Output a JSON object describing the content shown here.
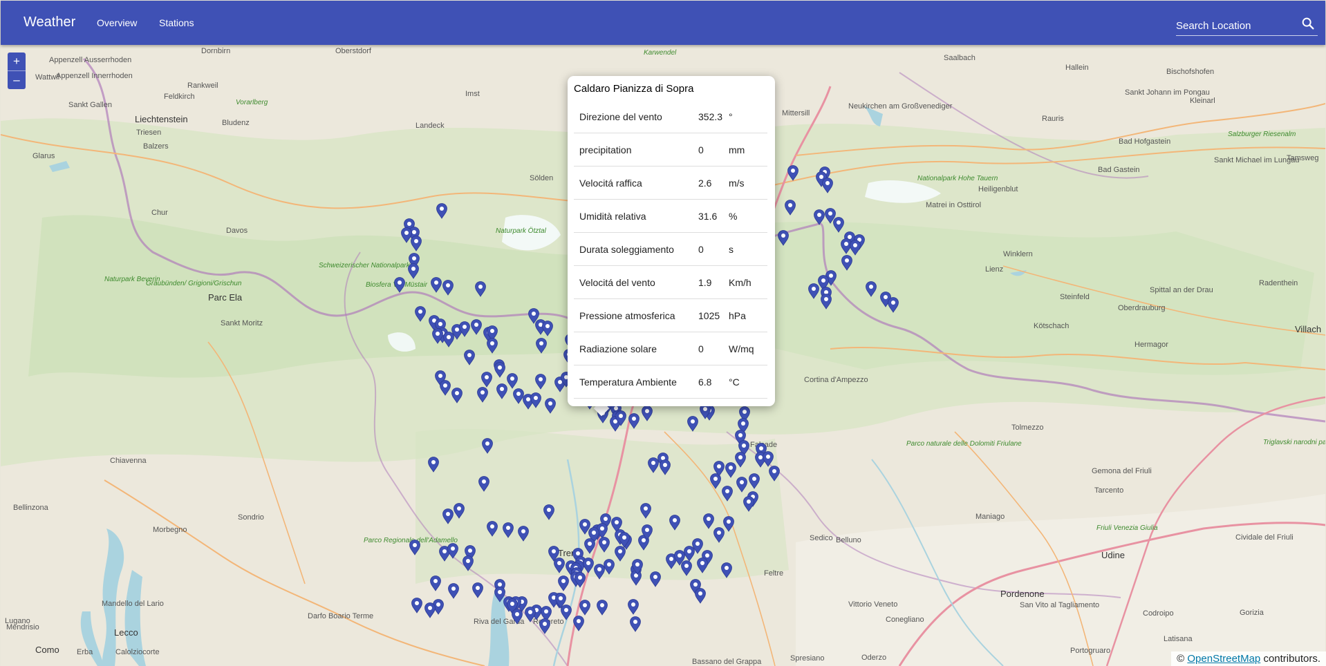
{
  "app": {
    "title": "Weather",
    "nav": [
      "Overview",
      "Stations"
    ]
  },
  "search": {
    "placeholder": "Search Location"
  },
  "zoom": {
    "in": "+",
    "out": "–"
  },
  "popup": {
    "title": "Caldaro Pianizza di Sopra",
    "rows": [
      {
        "name": "Direzione del vento",
        "value": "352.3",
        "unit": "°"
      },
      {
        "name": "precipitation",
        "value": "0",
        "unit": "mm"
      },
      {
        "name": "Velocitá raffica",
        "value": "2.6",
        "unit": "m/s"
      },
      {
        "name": "Umidità relativa",
        "value": "31.6",
        "unit": "%"
      },
      {
        "name": "Durata soleggiamento",
        "value": "0",
        "unit": "s"
      },
      {
        "name": "Velocitá del vento",
        "value": "1.9",
        "unit": "Km/h"
      },
      {
        "name": "Pressione atmosferica",
        "value": "1025",
        "unit": "hPa"
      },
      {
        "name": "Radiazione solare",
        "value": "0",
        "unit": "W/mq"
      },
      {
        "name": "Temperatura Ambiente",
        "value": "6.8",
        "unit": "°C"
      }
    ]
  },
  "attribution": {
    "prefix": "© ",
    "link": "OpenStreetMap",
    "suffix": " contributors."
  },
  "map_labels": [
    "Dornbirn",
    "Oberstdorf",
    "Appenzell Ausserrhoden",
    "Appenzell Innerrhoden",
    "Wattwil",
    "Rankweil",
    "Feldkirch",
    "Sankt Gallen",
    "Liechtenstein",
    "Triesen",
    "Balzers",
    "Vorarlberg",
    "Bludenz",
    "Imst",
    "Landeck",
    "Glarus",
    "Chur",
    "Davos",
    "Parc Ela",
    "Sankt Moritz",
    "Schweizerischer Nationalpark",
    "Naturpark Beverin",
    "Graubünden/ Grigioni/Grischun",
    "Biosfera Val Müstair",
    "Sölden",
    "Naturpark Ötztal",
    "Chiavenna",
    "Bellinzona",
    "Sondrio",
    "Morbegno",
    "Lugano",
    "Mendrisio",
    "Lecco",
    "Como",
    "Erba",
    "Calolziocorte",
    "Mandello del Lario",
    "Darfo Boario Terme",
    "Parco Regionale dell'Adamello",
    "Trento",
    "Riva del Garda",
    "Rovereto",
    "Karwendel",
    "Saalbach",
    "Hallein",
    "Bischofshofen",
    "Bad Hofgastein",
    "Bad Gastein",
    "Salzburger Riesenalm",
    "Nationalpark Hohe Tauern",
    "Heiligenblut",
    "Matrei in Osttirol",
    "Lienz",
    "Spittal an der Drau",
    "Villach",
    "Cortina d'Ampezzo",
    "Tolmezzo",
    "Udine",
    "Pordenone",
    "Conegliano",
    "Vittorio Veneto",
    "Feltre",
    "Belluno",
    "Bassano del Grappa",
    "Gemona del Friuli",
    "Tarcento",
    "Maniago",
    "Sedico",
    "Falcade",
    "Parco naturale delle Dolomiti Friulane",
    "Triglavski narodni park",
    "Friuli Venezia Giulia",
    "Sankt Johann im Pongau",
    "Radenthein",
    "Steinfeld",
    "Kötschach",
    "Winklern",
    "Oberdrauburg",
    "Neukirchen am Großvenediger",
    "Mittersill",
    "Rauris",
    "Kleinarl",
    "Tamsweg",
    "Sankt Michael im Lungau",
    "Hermagor",
    "Cividale del Friuli",
    "Gorizia",
    "Oderzo",
    "Spresiano",
    "Portogruaro",
    "Latisana",
    "Codroipo",
    "San Vito al Tagliamento"
  ]
}
